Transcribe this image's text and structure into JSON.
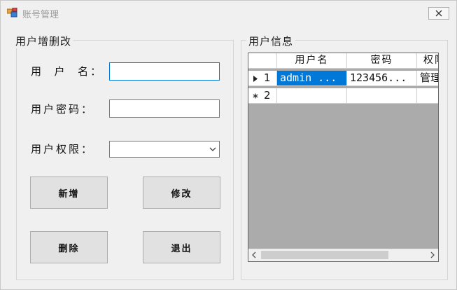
{
  "window": {
    "title": "账号管理",
    "close_glyph": "✕"
  },
  "edit_group": {
    "legend": "用户增删改",
    "username_label": "用  户  名：",
    "username_value": "",
    "password_label": "用户密码：",
    "password_value": "",
    "permission_label": "用户权限：",
    "permission_selected": "",
    "buttons": {
      "add": "新增",
      "modify": "修改",
      "delete": "删除",
      "exit": "退出"
    }
  },
  "info_group": {
    "legend": "用户信息",
    "grid": {
      "columns": [
        "用户名",
        "密码",
        "权限"
      ],
      "rows": [
        {
          "num": "1",
          "marker": "current-row-arrow-icon",
          "cells": [
            "admin ...",
            "123456...",
            "管理"
          ]
        },
        {
          "num": "2",
          "marker": "new-row-asterisk-icon",
          "cells": [
            "",
            "",
            ""
          ]
        }
      ],
      "horizontal_scroll_fraction": 0.0
    }
  },
  "colors": {
    "selection": "#0078d7",
    "grid_background": "#ababab",
    "window_background": "#f0f0f0"
  }
}
